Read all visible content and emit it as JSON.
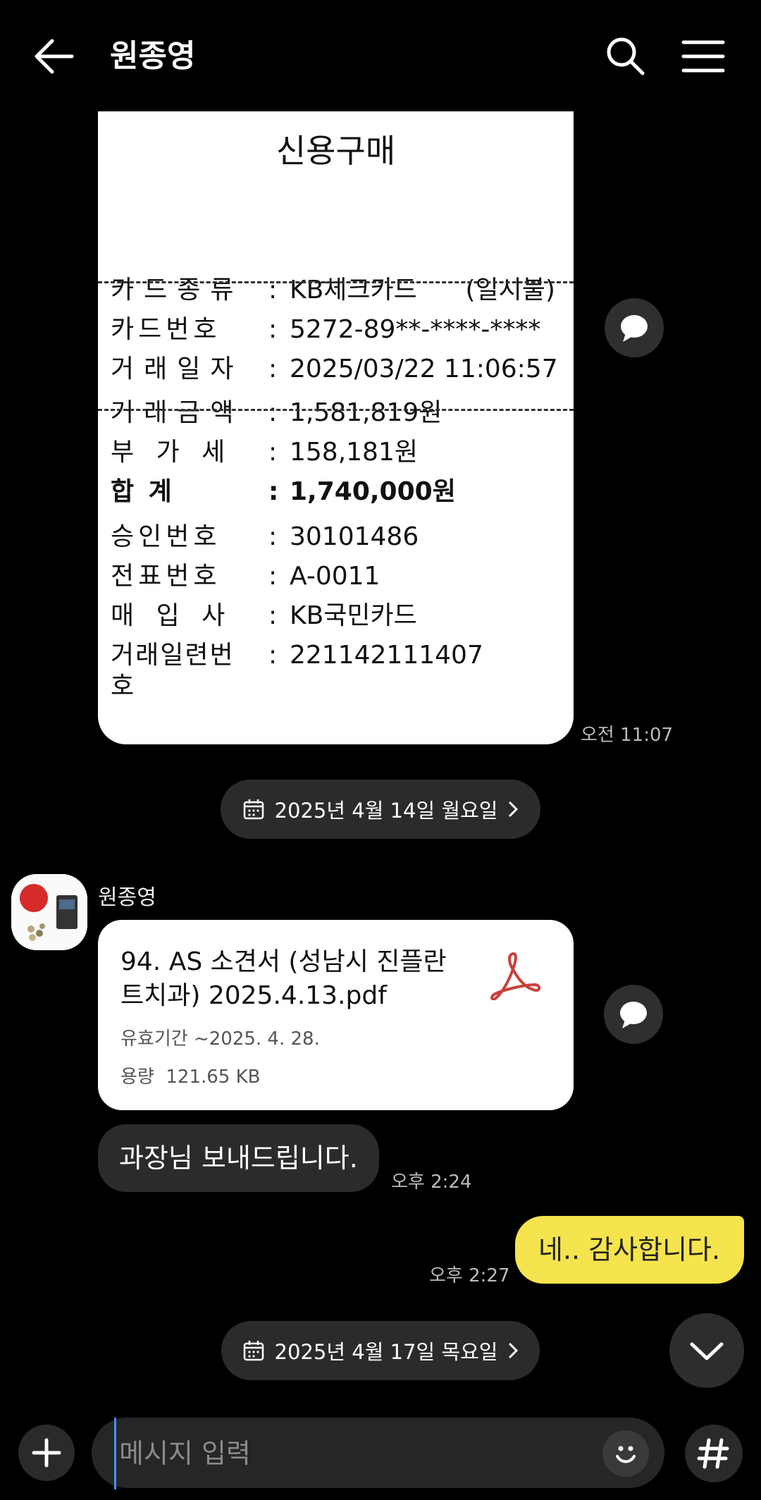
{
  "header": {
    "title": "원종영"
  },
  "receipt": {
    "title": "신용구매",
    "rows": [
      {
        "label": "카드종류",
        "colon": ":",
        "value": "KB체크카드      (일시불)"
      },
      {
        "label": "카드번호",
        "colon": ":",
        "value": "5272-89**-****-****"
      },
      {
        "label": "거래일자",
        "colon": ":",
        "value": "2025/03/22 11:06:57"
      },
      {
        "label": "거래금액",
        "colon": ":",
        "value": "1,581,819원"
      },
      {
        "label": "부 가 세",
        "colon": ":",
        "value": "158,181원"
      },
      {
        "label": "합 계",
        "colon": ":",
        "value": "1,740,000원"
      },
      {
        "label": "승인번호",
        "colon": ":",
        "value": "30101486"
      },
      {
        "label": "전표번호",
        "colon": ":",
        "value": "A-0011"
      },
      {
        "label": "매 입 사",
        "colon": ":",
        "value": "KB국민카드"
      },
      {
        "label": "거래일련번",
        "label_cont": "호",
        "colon": ":",
        "value": "221142111407"
      }
    ],
    "time": "오전 11:07"
  },
  "date_separators": [
    {
      "label": "2025년 4월 14일 월요일"
    },
    {
      "label": "2025년 4월 17일 목요일"
    }
  ],
  "incoming": {
    "sender": "원종영",
    "file": {
      "name": "94. AS 소견서 (성남시 진플란트치과) 2025.4.13.pdf",
      "expiry": "유효기간 ~2025. 4. 28.",
      "size": "용량  121.65 KB",
      "icon": "pdf-icon"
    },
    "message": "과장님 보내드립니다.",
    "time": "오후 2:24"
  },
  "outgoing": {
    "message": "네.. 감사합니다.",
    "time": "오후 2:27"
  },
  "composer": {
    "placeholder": "메시지 입력"
  },
  "colors": {
    "background": "#000000",
    "my_bubble": "#f5e44d",
    "other_bubble": "#2b2b2b",
    "pdf_red": "#c8413a"
  }
}
